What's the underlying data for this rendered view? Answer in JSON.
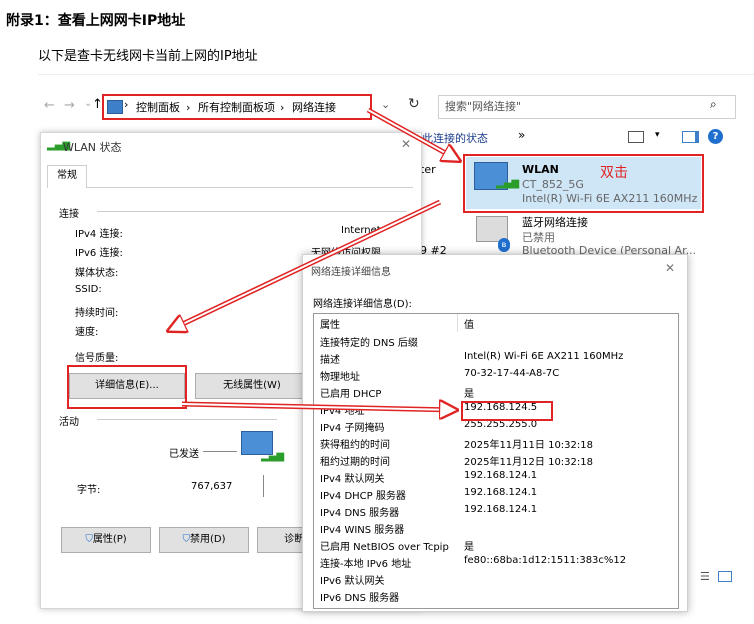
{
  "doc": {
    "heading": "附录1：查看上网网卡IP地址",
    "intro": "以下是查卡无线网卡当前上网的IP地址"
  },
  "explorer": {
    "nav_back": "←",
    "nav_forward": "→",
    "nav_up": "↑",
    "breadcrumb": [
      "控制面板",
      "所有控制面板项",
      "网络连接"
    ],
    "search_placeholder": "搜索\"网络连接\"",
    "cmd_status": "查看此连接的状态",
    "cmd_more": "»",
    "networks": [
      {
        "name": "WLAN",
        "ssid": "CT_852_5G",
        "device": "Intel(R) Wi-Fi 6E AX211 160MHz",
        "annotation": "双击"
      },
      {
        "name": "蓝牙网络连接",
        "ssid": "已禁用",
        "device": "Bluetooth Device (Personal Ar..."
      }
    ],
    "partial_left": "ter",
    "partial_left2": "9 #2"
  },
  "wlan_dialog": {
    "title": "WLAN 状态",
    "tab": "常规",
    "section_connection": "连接",
    "rows": [
      {
        "label": "IPv4 连接:",
        "value": "Internet"
      },
      {
        "label": "IPv6 连接:",
        "value": "无网络访问权限"
      },
      {
        "label": "媒体状态:",
        "value": ""
      },
      {
        "label": "SSID:",
        "value": ""
      },
      {
        "label": "持续时间:",
        "value": ""
      },
      {
        "label": "速度:",
        "value": ""
      }
    ],
    "signal_label": "信号质量:",
    "details_button": "详细信息(E)...",
    "wireless_button": "无线属性(W)",
    "section_activity": "活动",
    "sent_label": "已发送",
    "bytes_label": "字节:",
    "bytes_value": "767,637",
    "properties_button": "属性(P)",
    "disable_button": "禁用(D)",
    "diagnose_button": "诊断(G"
  },
  "details_dialog": {
    "title": "网络连接详细信息",
    "heading": "网络连接详细信息(D):",
    "col_property": "属性",
    "col_value": "值",
    "rows": [
      {
        "p": "连接特定的 DNS 后缀",
        "v": ""
      },
      {
        "p": "描述",
        "v": "Intel(R) Wi-Fi 6E AX211 160MHz"
      },
      {
        "p": "物理地址",
        "v": "70-32-17-44-A8-7C"
      },
      {
        "p": "已启用 DHCP",
        "v": "是"
      },
      {
        "p": "IPv4 地址",
        "v": "192.168.124.5"
      },
      {
        "p": "IPv4 子网掩码",
        "v": "255.255.255.0"
      },
      {
        "p": "获得租约的时间",
        "v": "2025年11月11日 10:32:18"
      },
      {
        "p": "租约过期的时间",
        "v": "2025年11月12日 10:32:18"
      },
      {
        "p": "IPv4 默认网关",
        "v": "192.168.124.1"
      },
      {
        "p": "IPv4 DHCP 服务器",
        "v": "192.168.124.1"
      },
      {
        "p": "IPv4 DNS 服务器",
        "v": "192.168.124.1"
      },
      {
        "p": "IPv4 WINS 服务器",
        "v": ""
      },
      {
        "p": "已启用 NetBIOS over Tcpip",
        "v": "是"
      },
      {
        "p": "连接-本地 IPv6 地址",
        "v": "fe80::68ba:1d12:1511:383c%12"
      },
      {
        "p": "IPv6 默认网关",
        "v": ""
      },
      {
        "p": "IPv6 DNS 服务器",
        "v": ""
      }
    ]
  },
  "colors": {
    "annotation_red": "#e02424",
    "selection_bg": "#cfe6f7",
    "link_blue": "#1a3c8c"
  }
}
